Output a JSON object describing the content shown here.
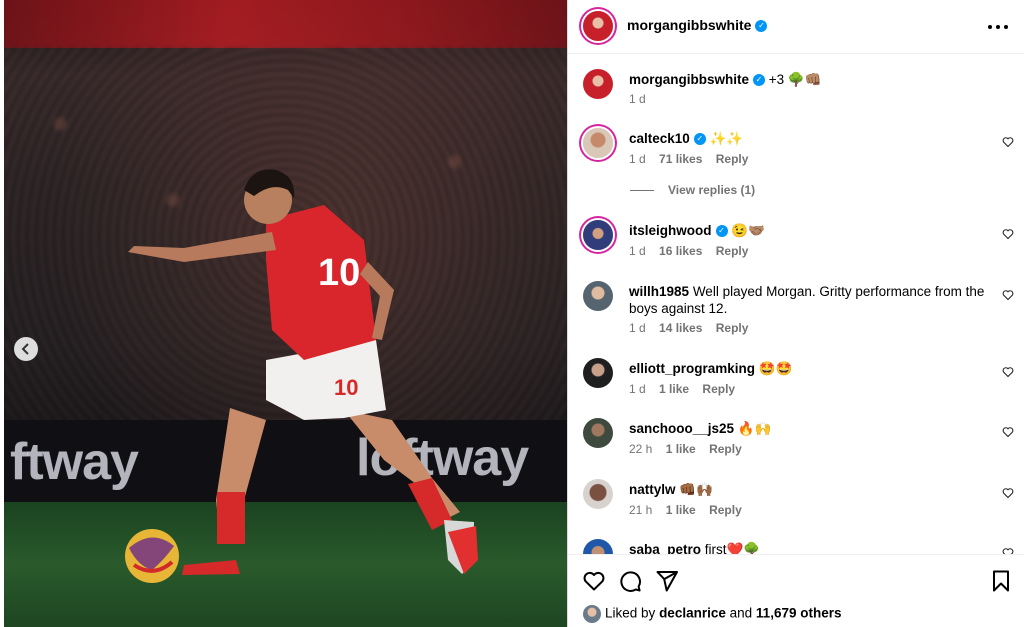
{
  "post": {
    "photo": {
      "board_text_left": "ftway",
      "board_text_right": "loftway",
      "prev_icon": "chevron-left-icon"
    },
    "header": {
      "username": "morgangibbswhite",
      "verified": true,
      "more_icon": "more-horizontal-icon"
    },
    "caption": {
      "username": "morgangibbswhite",
      "text": "+3 🌳👊🏽",
      "time": "1 d"
    },
    "comments": [
      {
        "username": "calteck10",
        "verified": true,
        "text": "✨✨",
        "time": "1 d",
        "likes": "71 likes",
        "reply": "Reply"
      },
      {
        "username": "itsleighwood",
        "verified": true,
        "text": "😉🤝🏽",
        "time": "1 d",
        "likes": "16 likes",
        "reply": "Reply"
      },
      {
        "username": "willh1985",
        "verified": false,
        "text": "Well played Morgan. Gritty performance from the boys against 12.",
        "time": "1 d",
        "likes": "14 likes",
        "reply": "Reply"
      },
      {
        "username": "elliott_programking",
        "verified": false,
        "text": "🤩🤩",
        "time": "1 d",
        "likes": "1 like",
        "reply": "Reply"
      },
      {
        "username": "sanchooo__js25",
        "verified": false,
        "text": "🔥🙌",
        "time": "22 h",
        "likes": "1 like",
        "reply": "Reply"
      },
      {
        "username": "nattylw",
        "verified": false,
        "text": "👊🏾🙌🏾",
        "time": "21 h",
        "likes": "1 like",
        "reply": "Reply"
      },
      {
        "username": "saba_petro",
        "verified": false,
        "text": "first❤️🌳",
        "time": "",
        "likes": "",
        "reply": ""
      }
    ],
    "view_replies": "View replies (1)",
    "actions": {
      "like_icon": "heart-icon",
      "comment_icon": "comment-icon",
      "share_icon": "send-icon",
      "save_icon": "bookmark-icon"
    },
    "liked_by": {
      "prefix": "Liked by",
      "user": "declanrice",
      "conjunction": "and",
      "others": "11,679 others"
    }
  }
}
